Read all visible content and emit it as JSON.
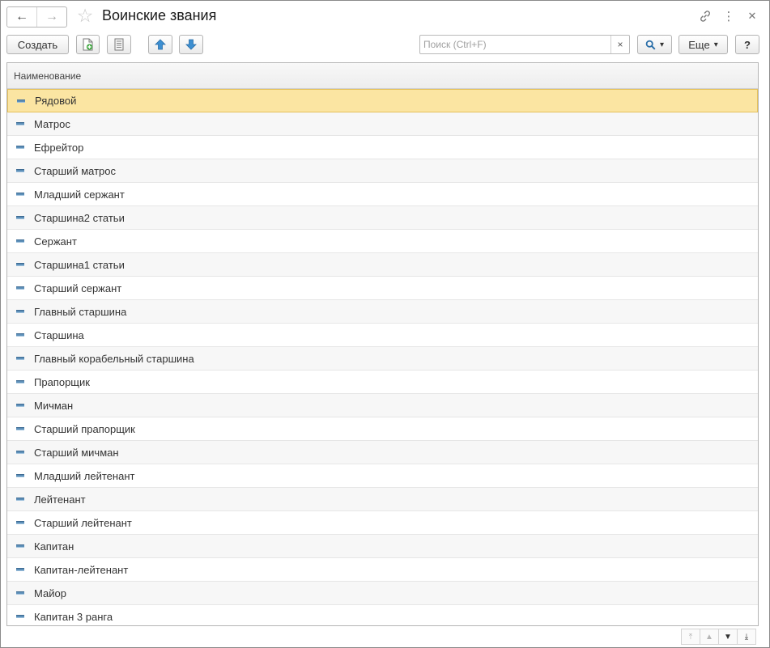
{
  "window": {
    "title": "Воинские звания",
    "back_glyph": "←",
    "forward_glyph": "→",
    "star_glyph": "☆",
    "link_glyph": "⚯",
    "menu_glyph": "⋮",
    "close_glyph": "✕"
  },
  "toolbar": {
    "create_label": "Создать",
    "search_placeholder": "Поиск (Ctrl+F)",
    "search_value": "",
    "clear_glyph": "×",
    "search_glyph": "⌕",
    "dropdown_glyph": "▾",
    "more_label": "Еще",
    "help_label": "?"
  },
  "table": {
    "column_header": "Наименование",
    "selected_index": 0,
    "rows": [
      "Рядовой",
      "Матрос",
      "Ефрейтор",
      "Старший матрос",
      "Младший сержант",
      "Старшина2 статьи",
      "Сержант",
      "Старшина1 статьи",
      "Старший сержант",
      "Главный старшина",
      "Старшина",
      "Главный корабельный старшина",
      "Прапорщик",
      "Мичман",
      "Старший прапорщик",
      "Старший мичман",
      "Младший лейтенант",
      "Лейтенант",
      "Старший лейтенант",
      "Капитан",
      "Капитан-лейтенант",
      "Майор",
      "Капитан 3 ранга"
    ]
  },
  "scroll": {
    "first_glyph": "⤒",
    "up_glyph": "▲",
    "down_glyph": "▼",
    "last_glyph": "⤓"
  },
  "colors": {
    "selected_row": "#fbe5a2",
    "accent_arrow": "#3d8fd1",
    "add_icon_green": "#3aa53a"
  }
}
